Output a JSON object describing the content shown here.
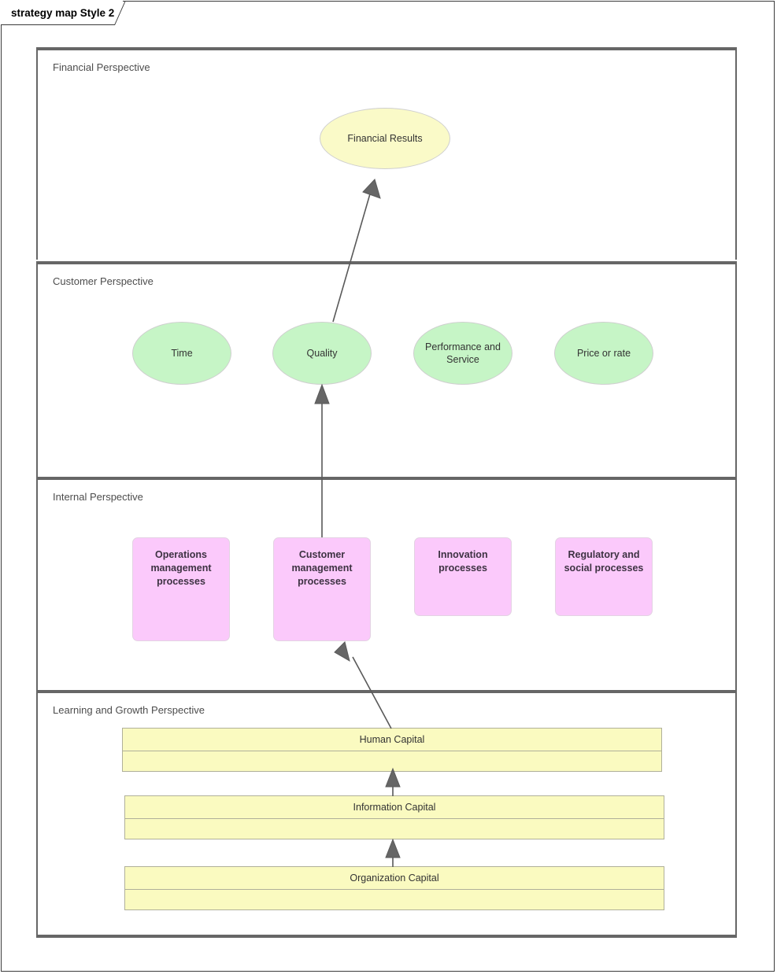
{
  "window": {
    "tab_label": "strategy map Style 2"
  },
  "colors": {
    "financial_node_fill": "#FAFAC8",
    "customer_node_fill": "#C6F5C6",
    "internal_node_fill": "#FBC9FB",
    "learning_node_fill": "#FAFAC0",
    "band_border": "#666666",
    "connector": "#595959",
    "label_text": "#4D4D4D"
  },
  "perspectives": [
    {
      "label": "Financial Perspective"
    },
    {
      "label": "Customer Perspective"
    },
    {
      "label": "Internal Perspective"
    },
    {
      "label": "Learning and Growth Perspective"
    }
  ],
  "financial": {
    "nodes": [
      {
        "label": "Financial Results"
      }
    ]
  },
  "customer": {
    "nodes": [
      {
        "label": "Time"
      },
      {
        "label": "Quality"
      },
      {
        "label": "Performance and Service"
      },
      {
        "label": "Price or rate"
      }
    ]
  },
  "internal": {
    "nodes": [
      {
        "label": "Operations management processes"
      },
      {
        "label": "Customer management processes"
      },
      {
        "label": "Innovation processes"
      },
      {
        "label": "Regulatory and social processes"
      }
    ]
  },
  "learning": {
    "nodes": [
      {
        "label": "Human Capital",
        "body": ""
      },
      {
        "label": "Information Capital",
        "body": ""
      },
      {
        "label": "Organization Capital",
        "body": ""
      }
    ]
  },
  "connections": [
    {
      "from": "Quality",
      "to": "Financial Results"
    },
    {
      "from": "Customer management processes",
      "to": "Quality"
    },
    {
      "from": "Human Capital",
      "to": "Customer management processes"
    },
    {
      "from": "Information Capital",
      "to": "Human Capital"
    },
    {
      "from": "Organization Capital",
      "to": "Information Capital"
    }
  ]
}
